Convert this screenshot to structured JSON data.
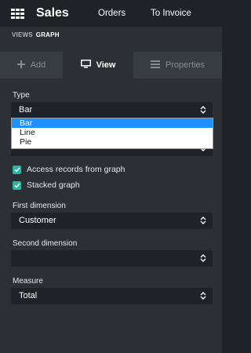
{
  "app": {
    "name": "Sales"
  },
  "nav": {
    "items": [
      "Orders",
      "To Invoice"
    ]
  },
  "breadcrumb": {
    "views": "VIEWS",
    "graph": "GRAPH"
  },
  "tabs": [
    {
      "label": "Add",
      "icon": "plus-icon",
      "active": false
    },
    {
      "label": "View",
      "icon": "monitor-icon",
      "active": true
    },
    {
      "label": "Properties",
      "icon": "list-icon",
      "active": false
    }
  ],
  "type": {
    "label": "Type",
    "value": "Bar",
    "options": [
      "Bar",
      "Line",
      "Pie"
    ],
    "selected_option": "Bar"
  },
  "checkboxes": [
    {
      "label": "Access records from graph",
      "checked": true
    },
    {
      "label": "Stacked graph",
      "checked": true
    }
  ],
  "first_dimension": {
    "label": "First dimension",
    "value": "Customer"
  },
  "second_dimension": {
    "label": "Second dimension",
    "value": ""
  },
  "measure": {
    "label": "Measure",
    "value": "Total"
  },
  "colors": {
    "accent": "#2bb5a0",
    "highlight": "#1e90ff",
    "navbar": "#1f2327",
    "panel": "#2c3035"
  }
}
